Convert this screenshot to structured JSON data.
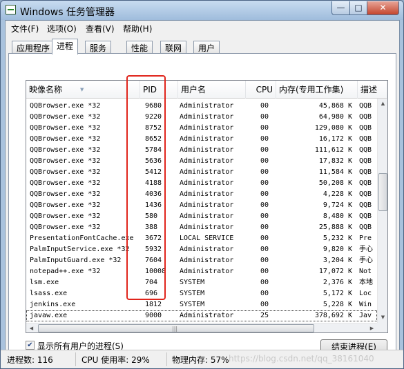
{
  "window": {
    "title": "Windows 任务管理器",
    "minimize": "—",
    "maximize": "□",
    "close": "✕"
  },
  "menu": [
    "文件(F)",
    "选项(O)",
    "查看(V)",
    "帮助(H)"
  ],
  "tabs": [
    "应用程序",
    "进程",
    "服务",
    "性能",
    "联网",
    "用户"
  ],
  "active_tab": "进程",
  "columns": {
    "name": "映像名称",
    "pid": "PID",
    "user": "用户名",
    "cpu": "CPU",
    "memory": "内存(专用工作集)",
    "desc": "描述"
  },
  "rows": [
    {
      "name": "QQBrowser.exe *32",
      "pid": "9680",
      "user": "Administrator",
      "cpu": "00",
      "memory": "45,868 K",
      "desc": "QQB"
    },
    {
      "name": "QQBrowser.exe *32",
      "pid": "9220",
      "user": "Administrator",
      "cpu": "00",
      "memory": "64,980 K",
      "desc": "QQB"
    },
    {
      "name": "QQBrowser.exe *32",
      "pid": "8752",
      "user": "Administrator",
      "cpu": "00",
      "memory": "129,080 K",
      "desc": "QQB"
    },
    {
      "name": "QQBrowser.exe *32",
      "pid": "8652",
      "user": "Administrator",
      "cpu": "00",
      "memory": "16,172 K",
      "desc": "QQB"
    },
    {
      "name": "QQBrowser.exe *32",
      "pid": "5784",
      "user": "Administrator",
      "cpu": "00",
      "memory": "111,612 K",
      "desc": "QQB"
    },
    {
      "name": "QQBrowser.exe *32",
      "pid": "5636",
      "user": "Administrator",
      "cpu": "00",
      "memory": "17,832 K",
      "desc": "QQB"
    },
    {
      "name": "QQBrowser.exe *32",
      "pid": "5412",
      "user": "Administrator",
      "cpu": "00",
      "memory": "11,584 K",
      "desc": "QQB"
    },
    {
      "name": "QQBrowser.exe *32",
      "pid": "4188",
      "user": "Administrator",
      "cpu": "00",
      "memory": "50,208 K",
      "desc": "QQB"
    },
    {
      "name": "QQBrowser.exe *32",
      "pid": "4036",
      "user": "Administrator",
      "cpu": "00",
      "memory": "4,228 K",
      "desc": "QQB"
    },
    {
      "name": "QQBrowser.exe *32",
      "pid": "1436",
      "user": "Administrator",
      "cpu": "00",
      "memory": "9,724 K",
      "desc": "QQB"
    },
    {
      "name": "QQBrowser.exe *32",
      "pid": "580",
      "user": "Administrator",
      "cpu": "00",
      "memory": "8,480 K",
      "desc": "QQB"
    },
    {
      "name": "QQBrowser.exe *32",
      "pid": "388",
      "user": "Administrator",
      "cpu": "00",
      "memory": "25,888 K",
      "desc": "QQB"
    },
    {
      "name": "PresentationFontCache.exe",
      "pid": "3672",
      "user": "LOCAL SERVICE",
      "cpu": "00",
      "memory": "5,232 K",
      "desc": "Pre"
    },
    {
      "name": "PalmInputService.exe *32",
      "pid": "5932",
      "user": "Administrator",
      "cpu": "00",
      "memory": "9,820 K",
      "desc": "手心"
    },
    {
      "name": "PalmInputGuard.exe *32",
      "pid": "7604",
      "user": "Administrator",
      "cpu": "00",
      "memory": "3,204 K",
      "desc": "手心"
    },
    {
      "name": "notepad++.exe *32",
      "pid": "10008",
      "user": "Administrator",
      "cpu": "00",
      "memory": "17,072 K",
      "desc": "Not"
    },
    {
      "name": "lsm.exe",
      "pid": "704",
      "user": "SYSTEM",
      "cpu": "00",
      "memory": "2,376 K",
      "desc": "本地"
    },
    {
      "name": "lsass.exe",
      "pid": "696",
      "user": "SYSTEM",
      "cpu": "00",
      "memory": "5,172 K",
      "desc": "Loc"
    },
    {
      "name": "jenkins.exe",
      "pid": "1812",
      "user": "SYSTEM",
      "cpu": "00",
      "memory": "5,228 K",
      "desc": "Win"
    },
    {
      "name": "javaw.exe",
      "pid": "9000",
      "user": "Administrator",
      "cpu": "25",
      "memory": "378,692 K",
      "desc": "Jav"
    }
  ],
  "selected_row": 19,
  "show_all_users": {
    "label": "显示所有用户的进程(S)",
    "checked": true
  },
  "end_process_button": "结束进程(E)",
  "status": {
    "processes": "进程数: 116",
    "cpu": "CPU 使用率: 29%",
    "memory": "物理内存: 57%"
  },
  "watermark": "https://blog.csdn.net/qq_38161040",
  "colors": {
    "highlight_box": "#e0241b",
    "titlebar": "#a9c2dd"
  }
}
